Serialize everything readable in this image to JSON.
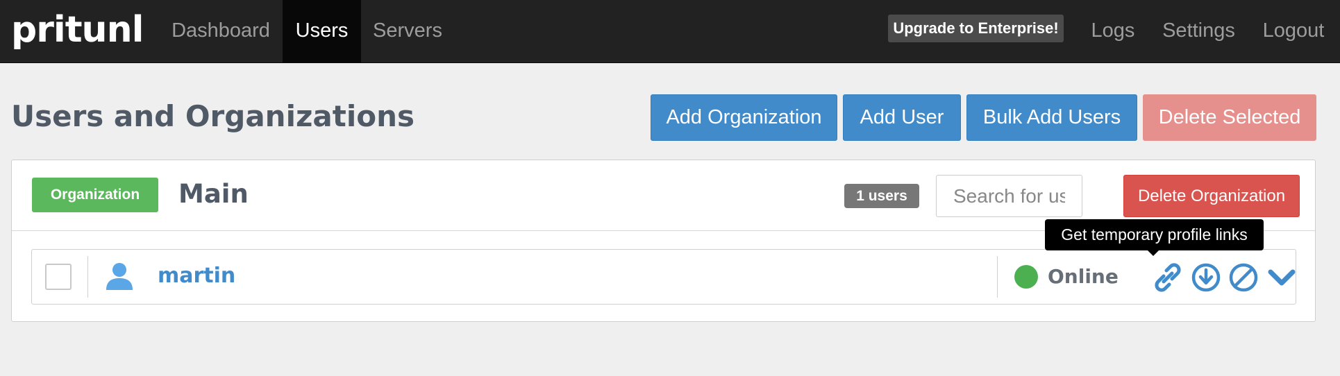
{
  "navbar": {
    "brand": "pritunl",
    "links": {
      "dashboard": "Dashboard",
      "users": "Users",
      "servers": "Servers"
    },
    "upgrade": "Upgrade to Enterprise!",
    "right_links": {
      "logs": "Logs",
      "settings": "Settings",
      "logout": "Logout"
    },
    "active": "Users"
  },
  "page": {
    "title": "Users and Organizations",
    "buttons": {
      "add_organization": "Add Organization",
      "add_user": "Add User",
      "bulk_add_users": "Bulk Add Users",
      "delete_selected": "Delete Selected"
    }
  },
  "organization": {
    "label": "Organization",
    "name": "Main",
    "user_count": "1 users",
    "search_placeholder": "Search for user",
    "delete_button": "Delete Organization",
    "users": [
      {
        "name": "martin",
        "status": "Online",
        "checked": false,
        "actions": [
          "link-icon",
          "download-icon",
          "disable-icon",
          "chevron-down-icon"
        ]
      }
    ]
  },
  "tooltip": {
    "text": "Get temporary profile links"
  },
  "colors": {
    "primary": "#428bca",
    "danger": "#d9534f",
    "danger_disabled": "#e6908d",
    "success": "#5cb85c",
    "online": "#4caf50",
    "navbar": "#222222"
  }
}
